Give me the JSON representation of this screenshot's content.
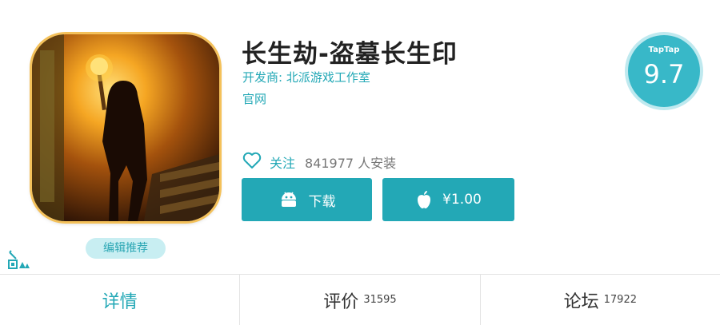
{
  "app": {
    "title": "长生劫-盗墓长生印",
    "developer": "开发商: 北派游戏工作室",
    "website": "官网",
    "recommend_badge": "编辑推荐"
  },
  "score": {
    "brand": "TapTap",
    "value": "9.7"
  },
  "follow": {
    "label": "关注",
    "installs": "841977 人安装"
  },
  "buttons": {
    "download": "下载",
    "buy": "¥1.00"
  },
  "tabs": [
    {
      "label": "详情",
      "count": ""
    },
    {
      "label": "评价",
      "count": "31595"
    },
    {
      "label": "论坛",
      "count": "17922"
    }
  ],
  "icons": {
    "follow": "heart-icon",
    "download": "android-icon",
    "buy": "apple-icon",
    "corner": "site-logo-icon"
  },
  "colors": {
    "accent": "#23a8b6",
    "badge_bg": "#c8eef2"
  }
}
